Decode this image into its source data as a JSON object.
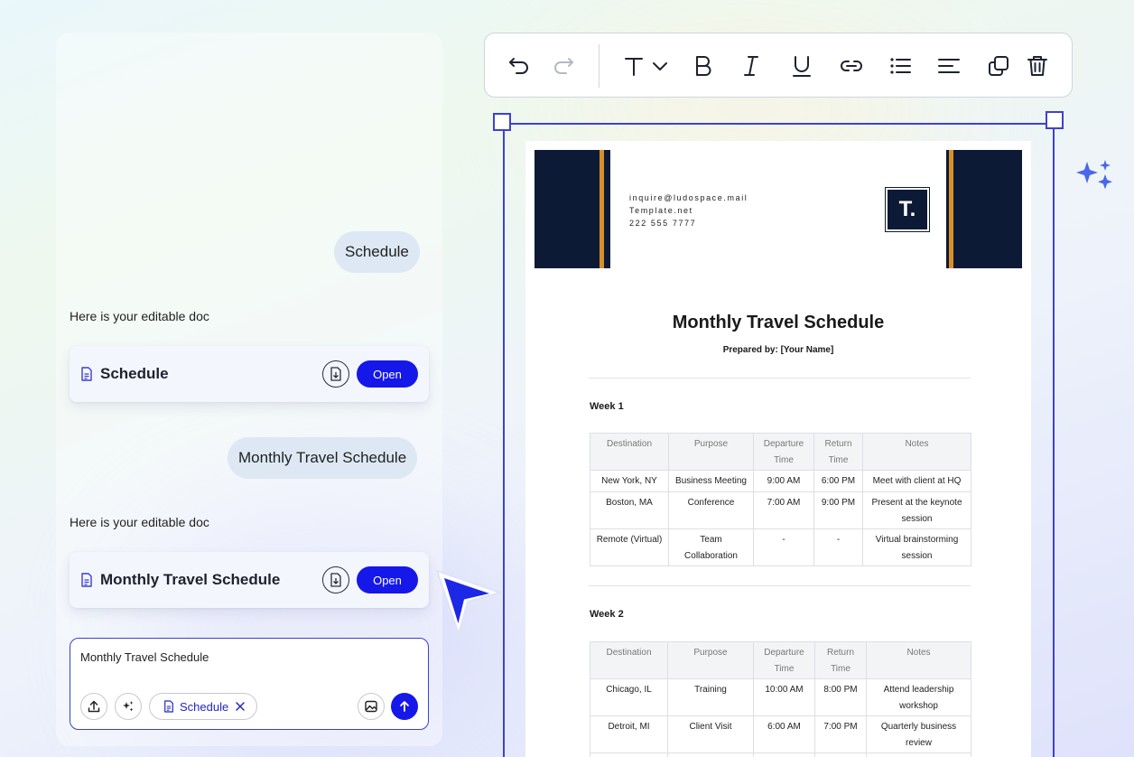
{
  "chat": {
    "messages": [
      {
        "role": "user",
        "text": "Schedule"
      },
      {
        "role": "assistant",
        "text": "Here is your editable doc",
        "card_title": "Schedule",
        "open_label": "Open"
      },
      {
        "role": "user",
        "text": "Monthly Travel Schedule"
      },
      {
        "role": "assistant",
        "text": "Here is your editable doc",
        "card_title": "Monthly Travel Schedule",
        "open_label": "Open"
      }
    ],
    "composer": {
      "value": "Monthly Travel Schedule",
      "chip_label": "Schedule"
    }
  },
  "toolbar": {
    "icons": [
      "undo-icon",
      "redo-icon",
      "text-style-icon",
      "chevron-down-icon",
      "bold-icon",
      "italic-icon",
      "underline-icon",
      "link-icon",
      "bullet-list-icon",
      "align-left-icon",
      "duplicate-icon",
      "delete-icon"
    ]
  },
  "document": {
    "contact": {
      "email": "inquire@ludospace.mail",
      "site": "Template.net",
      "phone": "222 555 7777"
    },
    "logo_letter": "T.",
    "title": "Monthly Travel Schedule",
    "prepared_by": "Prepared by: [Your Name]",
    "columns": [
      "Destination",
      "Purpose",
      "Departure Time",
      "Return Time",
      "Notes"
    ],
    "weeks": [
      {
        "label": "Week 1",
        "rows": [
          [
            "New York, NY",
            "Business Meeting",
            "9:00 AM",
            "6:00 PM",
            "Meet with client at HQ"
          ],
          [
            "Boston, MA",
            "Conference",
            "7:00 AM",
            "9:00 PM",
            "Present at the keynote session"
          ],
          [
            "Remote (Virtual)",
            "Team Collaboration",
            "-",
            "-",
            "Virtual brainstorming session"
          ]
        ]
      },
      {
        "label": "Week 2",
        "rows": [
          [
            "Chicago, IL",
            "Training",
            "10:00 AM",
            "8:00 PM",
            "Attend leadership workshop"
          ],
          [
            "Detroit, MI",
            "Client Visit",
            "6:00 AM",
            "7:00 PM",
            "Quarterly business review"
          ]
        ]
      }
    ]
  },
  "colors": {
    "accent": "#1518e8",
    "frame": "#3d42cf",
    "header_navy": "#0d1a35",
    "header_orange": "#d9902b"
  }
}
